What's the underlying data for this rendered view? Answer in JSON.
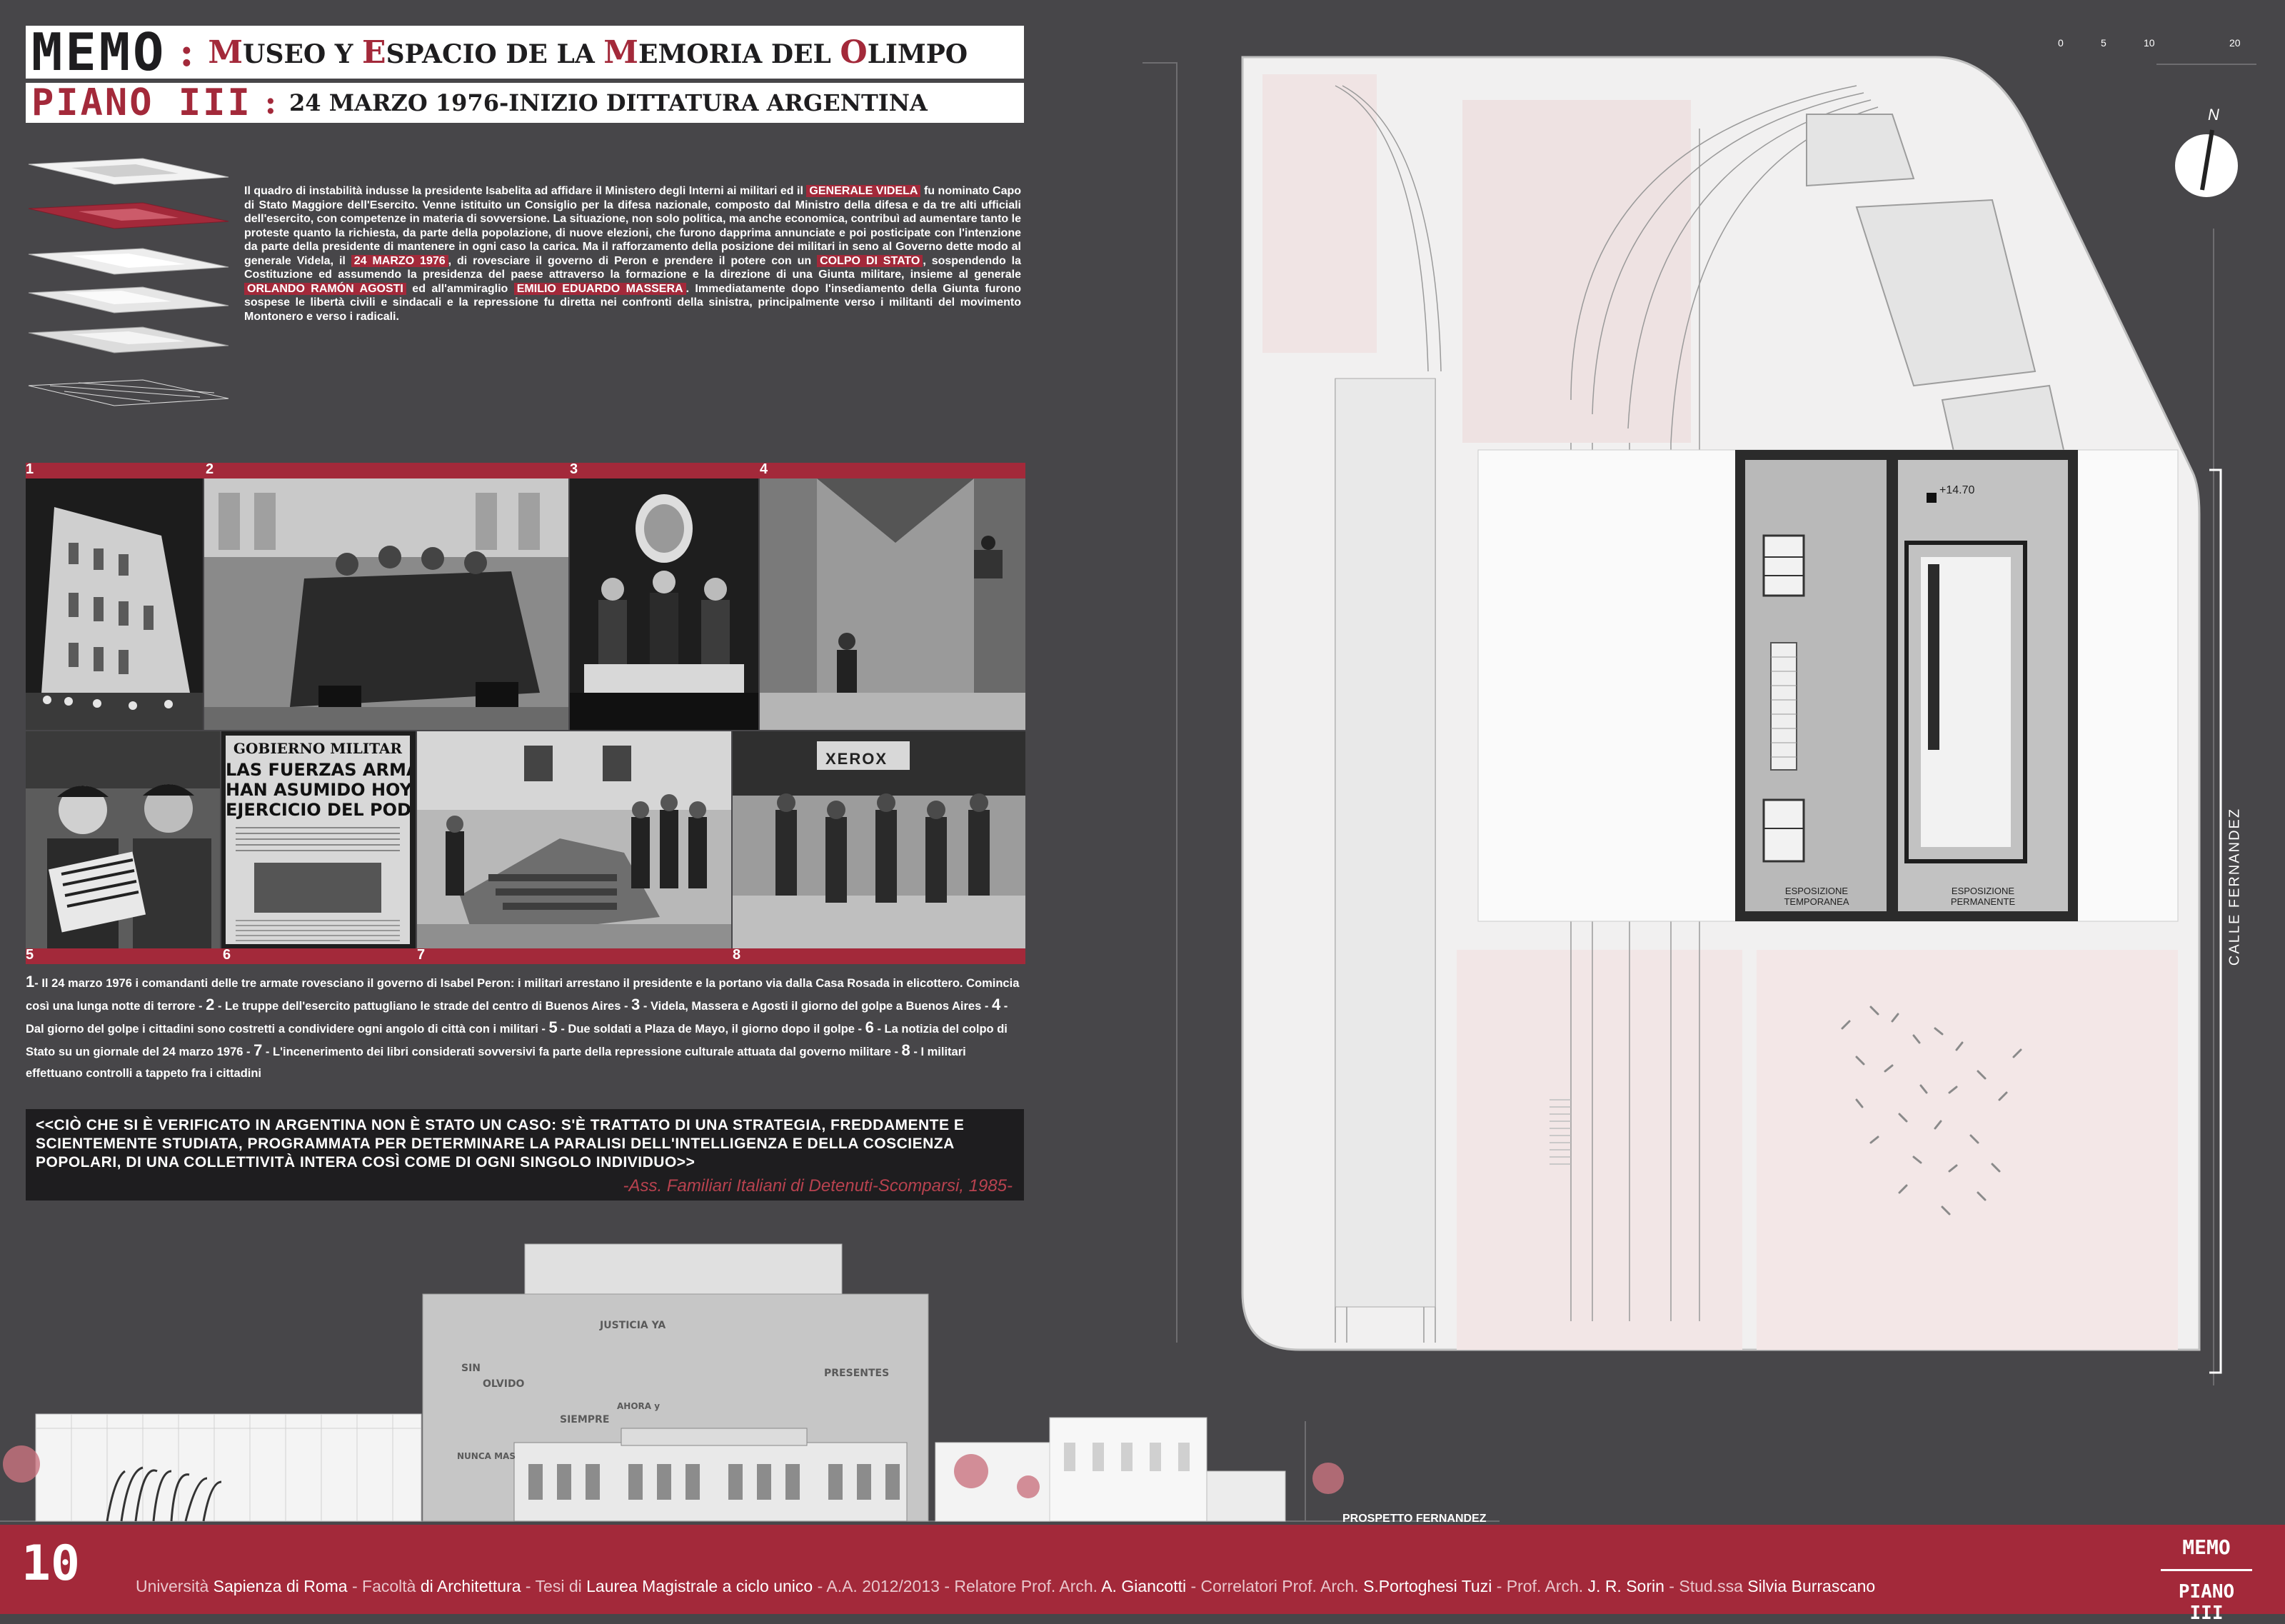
{
  "title": {
    "main": "MEMO",
    "separator": ":",
    "subtitle_parts": [
      {
        "t": "M",
        "red": true
      },
      {
        "t": "USEO Y ",
        "red": false
      },
      {
        "t": "E",
        "red": true
      },
      {
        "t": "SPACIO DE LA ",
        "red": false
      },
      {
        "t": "M",
        "red": true
      },
      {
        "t": "EMORIA DEL ",
        "red": false
      },
      {
        "t": "O",
        "red": true
      },
      {
        "t": "LIMPO",
        "red": false
      }
    ],
    "floor": "PIANO III",
    "floor_subtitle": "24 MARZO 1976-INIZIO DITTATURA ARGENTINA"
  },
  "intro_paragraph": [
    {
      "t": "Il quadro di instabilità indusse la presidente Isabelita ad affidare il Ministero degli Interni ai militari ed il "
    },
    {
      "t": "GENERALE VIDELA",
      "hl": true
    },
    {
      "t": " fu nominato Capo di Stato Maggiore dell'Esercito. Venne istituito un Consiglio per la difesa nazionale, composto dal Ministro della difesa e da tre alti ufficiali dell'esercito, con competenze in materia di sovversione. La situazione, non solo politica, ma anche economica, contribuì ad aumentare tanto le proteste quanto la richiesta, da parte della popolazione, di nuove elezioni, che furono dapprima annunciate e poi posticipate con l'intenzione da parte della presidente di mantenere in ogni caso la carica. Ma il rafforzamento della posizione dei militari in seno al Governo dette modo al generale Videla, il "
    },
    {
      "t": "24 MARZO 1976",
      "hl": true
    },
    {
      "t": ", di rovesciare il governo di Peron e prendere il potere con un "
    },
    {
      "t": "COLPO DI STATO",
      "hl": true
    },
    {
      "t": ", sospendendo la Costituzione ed assumendo la presidenza del paese attraverso la formazione e la direzione di una Giunta militare, insieme al generale "
    },
    {
      "t": "ORLANDO RAMÓN AGOSTI",
      "hl": true
    },
    {
      "t": " ed all'ammiraglio "
    },
    {
      "t": "EMILIO EDUARDO MASSERA",
      "hl": true
    },
    {
      "t": ". Immediatamente dopo l'insediamento della Giunta furono sospese le libertà civili e sindacali e la repressione fu diretta nei confronti della sinistra, principalmente verso i militanti del movimento Montonero e verso i radicali."
    }
  ],
  "photos": {
    "numbers": [
      "1",
      "2",
      "3",
      "4",
      "5",
      "6",
      "7",
      "8"
    ],
    "newspaper": {
      "line1": "GOBIERNO MILITAR",
      "line2": "LAS FUERZAS ARMADAS",
      "line3": "HAN ASUMIDO HOY EL",
      "line4": "EJERCICIO DEL PODER"
    },
    "sign": "XEROX"
  },
  "caption": [
    {
      "n": "1",
      "t": "- Il 24 marzo 1976 i comandanti delle tre armate rovesciano il governo di Isabel Peron: i militari arrestano il presidente e la portano via dalla Casa Rosada in elicottero. Comincia così una lunga notte di terrore - "
    },
    {
      "n": "2",
      "t": " - Le truppe dell'esercito pattugliano le strade del centro di Buenos Aires - "
    },
    {
      "n": "3",
      "t": " - Videla, Massera e Agosti il giorno del golpe a Buenos Aires - "
    },
    {
      "n": "4",
      "t": " - Dal giorno del golpe i cittadini sono costretti a condividere ogni angolo di città con i militari - "
    },
    {
      "n": "5",
      "t": " - Due soldati a Plaza de Mayo, il giorno dopo il golpe - "
    },
    {
      "n": "6",
      "t": " - La notizia del colpo di Stato su un giornale del 24 marzo 1976 - "
    },
    {
      "n": "7",
      "t": " - L'incenerimento dei libri considerati sovversivi fa parte della repressione culturale attuata dal governo militare - "
    },
    {
      "n": "8",
      "t": " - I militari effettuano controlli a tappeto fra i cittadini"
    }
  ],
  "quote": {
    "text": "<<CIÒ CHE SI È VERIFICATO IN ARGENTINA NON È STATO UN CASO: S'È TRATTATO DI UNA STRATEGIA, FREDDAMENTE E SCIENTEMENTE STUDIATA, PROGRAMMATA PER DETERMINARE LA PARALISI DELL'INTELLIGENZA E DELLA COSCIENZA POPOLARI, DI UNA COLLETTIVITÀ INTERA COSÌ COME DI OGNI SINGOLO INDIVIDUO>>",
    "source": "-Ass. Familiari Italiani di Detenuti-Scomparsi, 1985-"
  },
  "plan": {
    "scale_labels": [
      "0",
      "5",
      "10",
      "20"
    ],
    "north": "N",
    "level": "+14.70",
    "exhibition_temp": [
      "ESPOSIZIONE",
      "TEMPORANEA"
    ],
    "exhibition_perm": [
      "ESPOSIZIONE",
      "PERMANENTE"
    ],
    "street": "CALLE FERNANDEZ"
  },
  "elevation": {
    "label": "PROSPETTO FERNANDEZ",
    "wall_texts": [
      "JUSTICIA YA",
      "SIN",
      "OLVIDO",
      "PRESENTES",
      "AHORA y",
      "SIEMPRE",
      "NUNCA MAS"
    ]
  },
  "footer": {
    "page_number": "10",
    "logo_top": "MEMO",
    "logo_bottom": "PIANO III",
    "credits": [
      {
        "t": "Università ",
        "w": false
      },
      {
        "t": "Sapienza di Roma",
        "w": true
      },
      {
        "t": " - Facoltà ",
        "w": false
      },
      {
        "t": "di Architettura",
        "w": true
      },
      {
        "t": " - Tesi di ",
        "w": false
      },
      {
        "t": "Laurea Magistrale a ciclo unico",
        "w": true
      },
      {
        "t": " - A.A. 2012/2013 - Relatore Prof. Arch. ",
        "w": false
      },
      {
        "t": "A. Giancotti",
        "w": true
      },
      {
        "t": " - Correlatori Prof. Arch. ",
        "w": false
      },
      {
        "t": "S.Portoghesi Tuzi",
        "w": true
      },
      {
        "t": " - Prof. Arch. ",
        "w": false
      },
      {
        "t": "J. R. Sorin",
        "w": true
      },
      {
        "t": " - Stud.ssa ",
        "w": false
      },
      {
        "t": "Silvia Burrascano",
        "w": true
      }
    ]
  },
  "colors": {
    "accent": "#a3293a",
    "background": "#474649",
    "dark": "#1e1d1f"
  }
}
